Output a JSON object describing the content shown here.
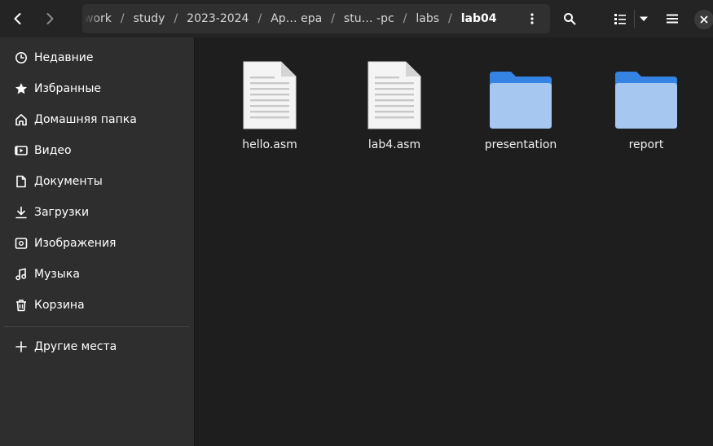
{
  "header": {
    "breadcrumb": [
      "work",
      "study",
      "2023-2024",
      "Ар… ера",
      "stu… -pc",
      "labs",
      "lab04"
    ],
    "separator": "/"
  },
  "sidebar": {
    "items": [
      {
        "label": "Недавние",
        "icon": "clock-icon"
      },
      {
        "label": "Избранные",
        "icon": "star-icon"
      },
      {
        "label": "Домашняя папка",
        "icon": "home-icon"
      },
      {
        "label": "Видео",
        "icon": "video-icon"
      },
      {
        "label": "Документы",
        "icon": "document-icon"
      },
      {
        "label": "Загрузки",
        "icon": "download-icon"
      },
      {
        "label": "Изображения",
        "icon": "image-icon"
      },
      {
        "label": "Музыка",
        "icon": "music-icon"
      },
      {
        "label": "Корзина",
        "icon": "trash-icon"
      }
    ],
    "other_places": "Другие места"
  },
  "files": [
    {
      "name": "hello.asm",
      "type": "text-file"
    },
    {
      "name": "lab4.asm",
      "type": "text-file"
    },
    {
      "name": "presentation",
      "type": "folder"
    },
    {
      "name": "report",
      "type": "folder"
    }
  ],
  "colors": {
    "folder_back": "#3584e4",
    "folder_front": "#a6c8f0",
    "sidebar_bg": "#2e2e2e",
    "main_bg": "#1e1e1e"
  }
}
